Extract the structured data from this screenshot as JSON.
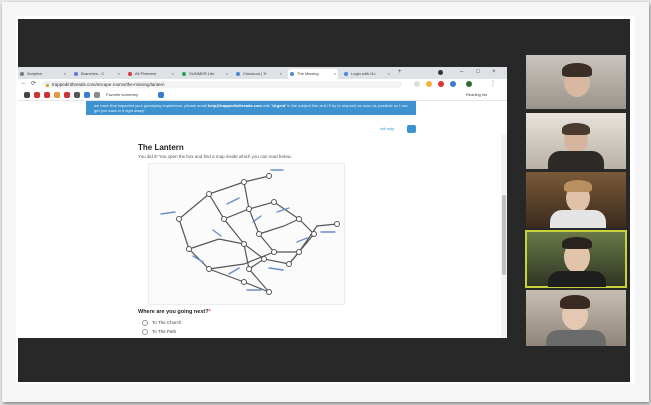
{
  "browser": {
    "tabs": [
      {
        "label": "Scriptive",
        "color": "#7a7a7a"
      },
      {
        "label": "Branches - C",
        "color": "#5a7bd6"
      },
      {
        "label": "All Pinterest",
        "color": "#d43b3b"
      },
      {
        "label": "SUMMER Libr",
        "color": "#2aa44a"
      },
      {
        "label": "Checkout | Tr",
        "color": "#4a88d6"
      },
      {
        "label": "The Missing",
        "color": "#4a88d6"
      },
      {
        "label": "Login with Go",
        "color": "#4a88d6"
      }
    ],
    "url": "trappedinthreads.com/escape-rooms/the-missing/lantern",
    "bookmarks_label": "Favorite summary",
    "reading_list_label": "Reading list"
  },
  "page": {
    "banner_text_1": "we have that impacted your gameplay experience, please email",
    "banner_email": "help@trappedinthreads.com",
    "banner_text_2": "with",
    "banner_urgent": "'Urgent'",
    "banner_text_3": "in the subject line and I'll try to respond as soon as possible so I can get you back in it right away!",
    "edit_label": "edit reply",
    "title": "The Lantern",
    "intro": "You did it! You open the box and find a map inside which you can read below.",
    "question": "Where are you going next?",
    "required_mark": "*",
    "options": [
      "To The Church",
      "To The Path"
    ]
  },
  "colors": {
    "accent": "#3d92cf",
    "active_speaker": "#c8d33b",
    "screen_bg": "#282828"
  }
}
